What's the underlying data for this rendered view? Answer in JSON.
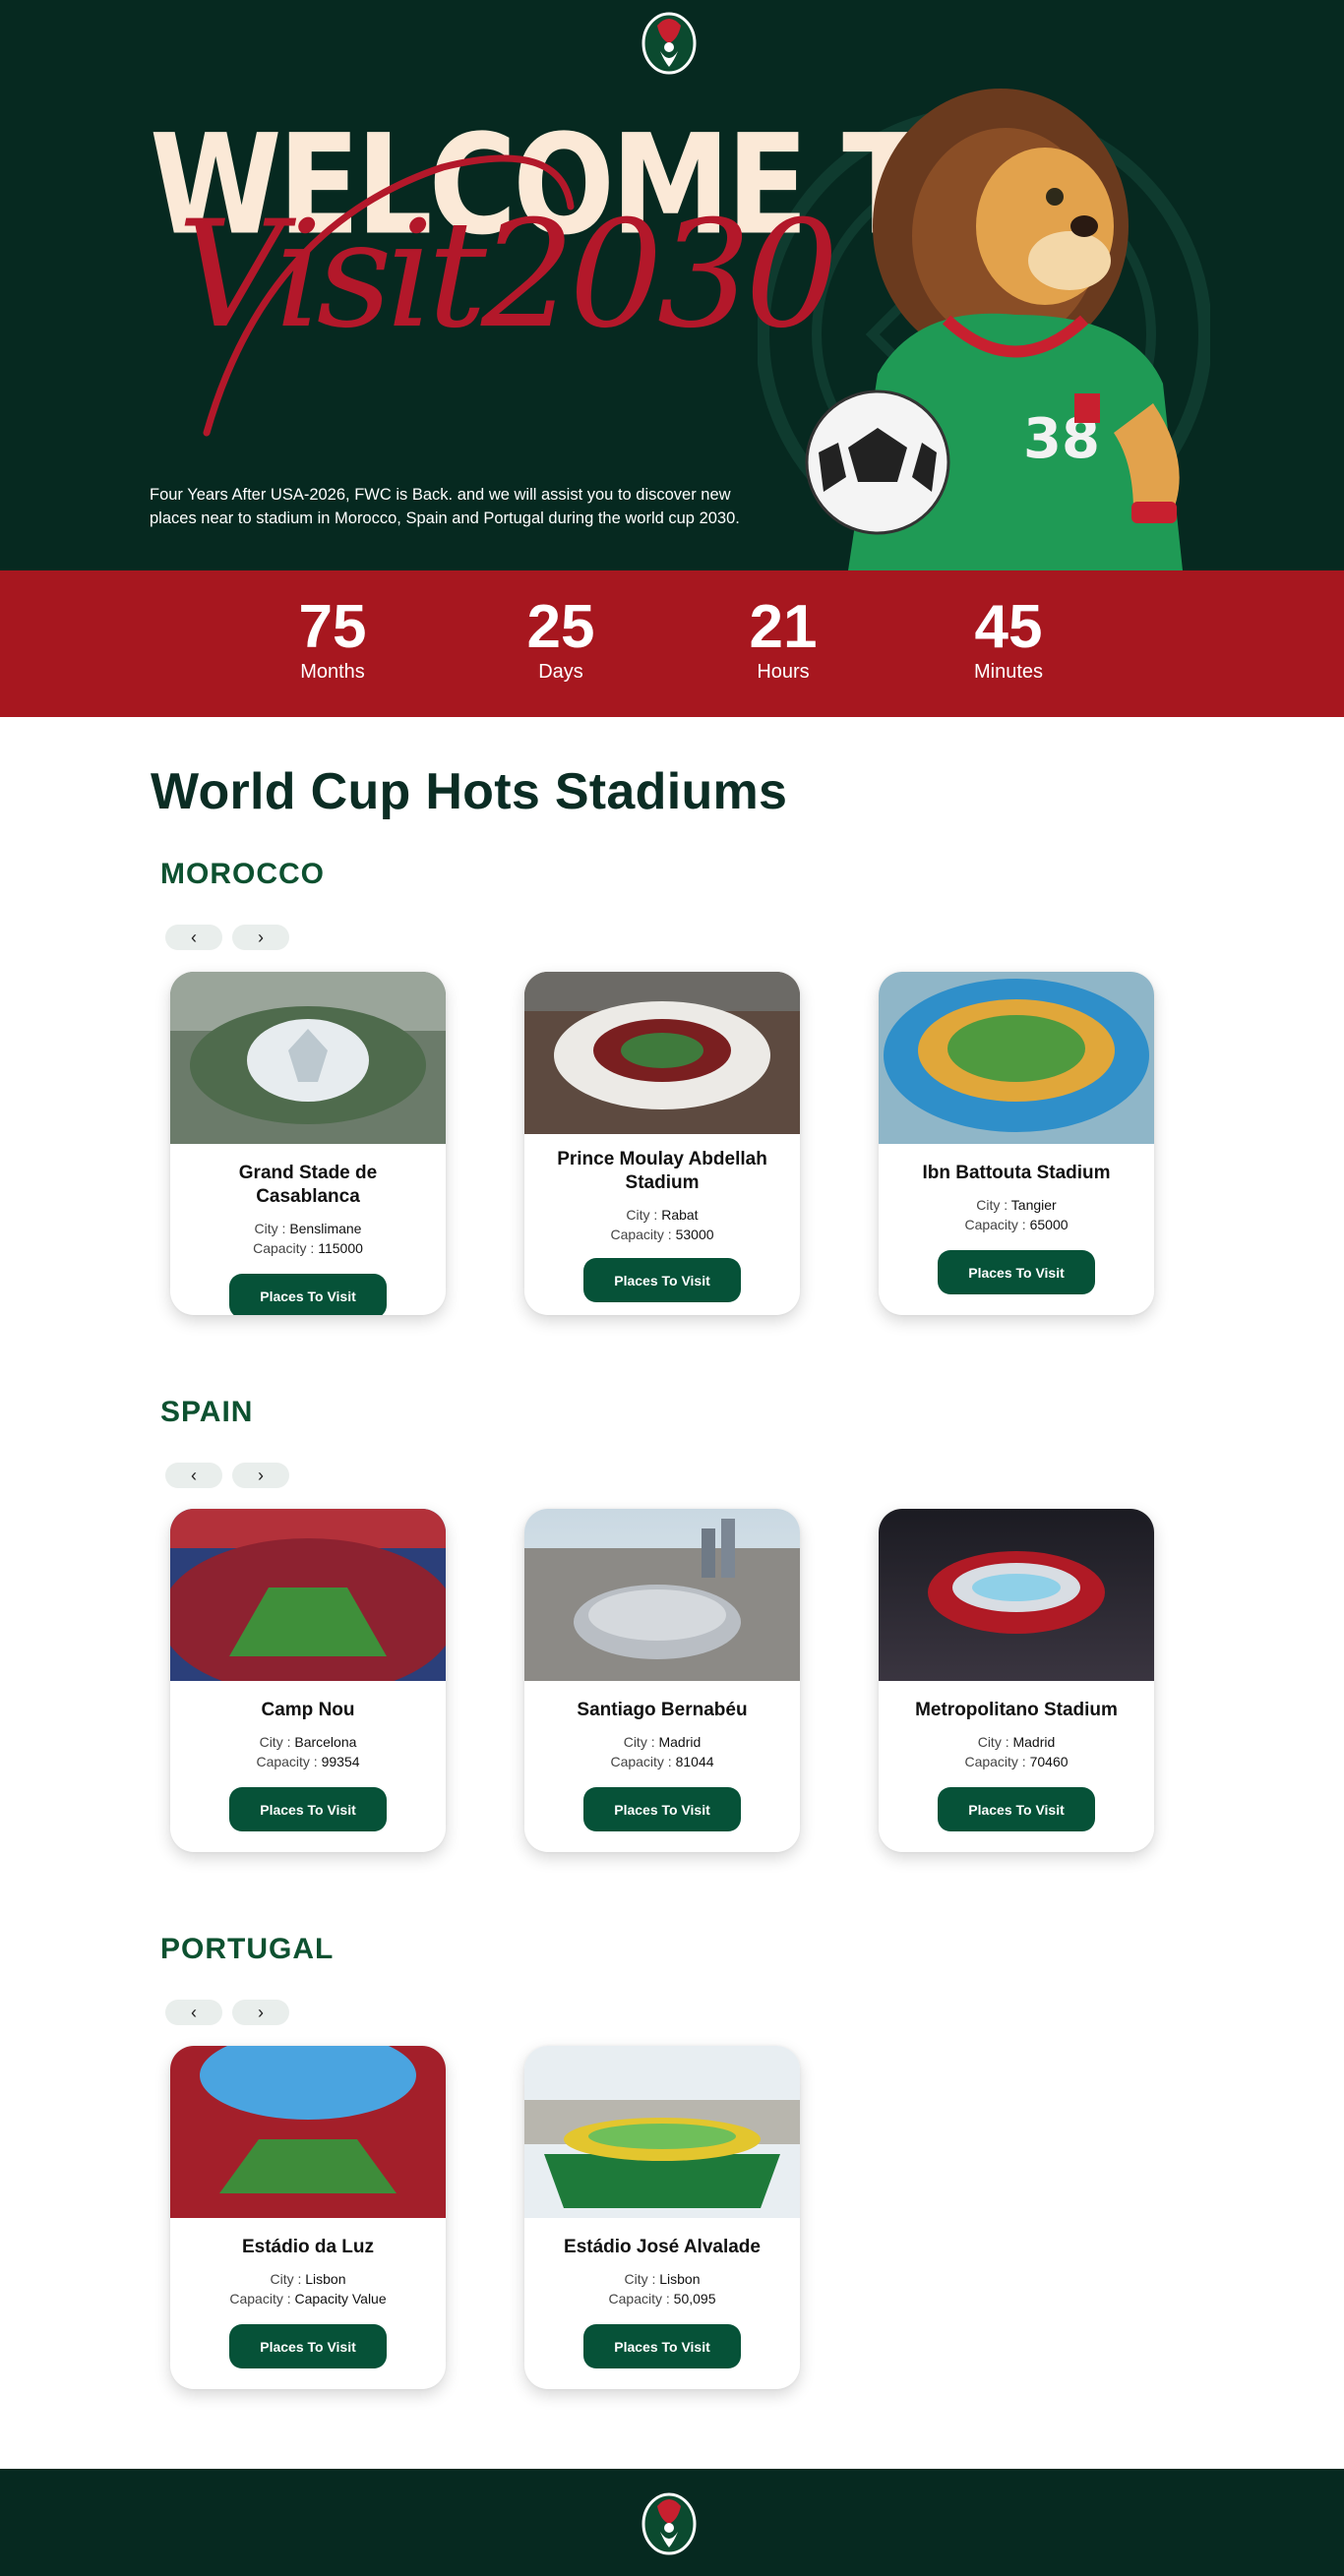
{
  "hero": {
    "welcome": "WELCOME TO",
    "script": "Visit2030",
    "description": "Four Years After USA-2026, FWC is Back. and we will assist you to discover new places near to stadium in Morocco, Spain and Portugal during the world cup 2030.",
    "mascot_shirt_number": "38"
  },
  "countdown": [
    {
      "value": "75",
      "label": "Months"
    },
    {
      "value": "25",
      "label": "Days"
    },
    {
      "value": "21",
      "label": "Hours"
    },
    {
      "value": "45",
      "label": "Minutes"
    }
  ],
  "main": {
    "title": "World Cup Hots Stadiums"
  },
  "labels": {
    "city": "City : ",
    "capacity": "Capacity : ",
    "button": "Places To Visit",
    "prev": "‹",
    "next": "›"
  },
  "sections": [
    {
      "country": "MOROCCO",
      "stadiums": [
        {
          "name": "Grand Stade de Casablanca",
          "city": "Benslimane",
          "capacity": "115000"
        },
        {
          "name": "Prince Moulay Abdellah Stadium",
          "city": "Rabat",
          "capacity": "53000"
        },
        {
          "name": "Ibn Battouta Stadium",
          "city": "Tangier",
          "capacity": "65000"
        }
      ]
    },
    {
      "country": "SPAIN",
      "stadiums": [
        {
          "name": "Camp Nou",
          "city": "Barcelona",
          "capacity": "99354"
        },
        {
          "name": "Santiago Bernabéu",
          "city": "Madrid",
          "capacity": "81044"
        },
        {
          "name": "Metropolitano Stadium",
          "city": "Madrid",
          "capacity": "70460"
        }
      ]
    },
    {
      "country": "PORTUGAL",
      "stadiums": [
        {
          "name": "Estádio da Luz",
          "city": "Lisbon",
          "capacity": "Capacity Value"
        },
        {
          "name": "Estádio José Alvalade",
          "city": "Lisbon",
          "capacity": "50,095"
        }
      ]
    }
  ],
  "colors": {
    "dark_green": "#062920",
    "accent_red": "#a7171f",
    "button_green": "#065238",
    "heading_green": "#0d5130",
    "cream": "#fbe9d7"
  }
}
